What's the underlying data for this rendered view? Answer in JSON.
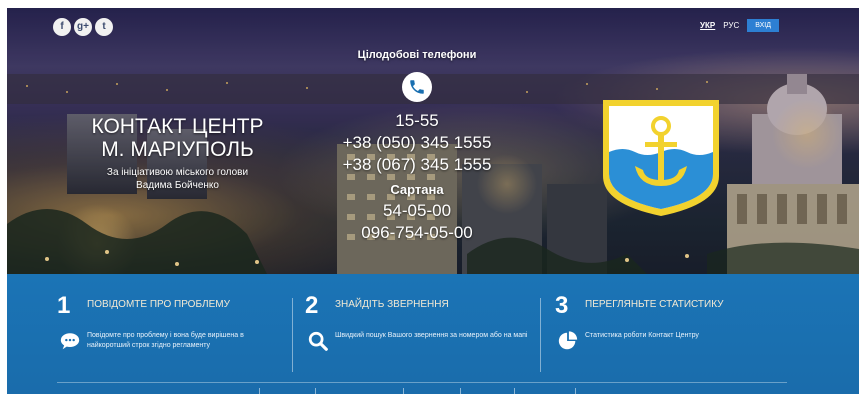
{
  "social": [
    {
      "name": "facebook",
      "glyph": "f"
    },
    {
      "name": "google-plus",
      "glyph": "g+"
    },
    {
      "name": "twitter",
      "glyph": "t"
    }
  ],
  "lang": {
    "ukr": "УКР",
    "rus": "РУС",
    "login": "ВХІД"
  },
  "title": {
    "line1": "КОНТАКТ ЦЕНТР",
    "line2": "М. МАРІУПОЛЬ",
    "line3": "За ініціативою міського голови",
    "line4": "Вадима Бойченко"
  },
  "phones": {
    "header": "Цілодобові телефони",
    "numbers": [
      "15-55",
      "+38 (050) 345 1555",
      "+38 (067) 345 1555"
    ],
    "sartana_label": "Сартана",
    "sartana_numbers": [
      "54-05-00",
      "096-754-05-00"
    ]
  },
  "steps": [
    {
      "number": "1",
      "heading": "ПОВІДОМТЕ ПРО ПРОБЛЕМУ",
      "text": "Повідомте про проблему і вона буде вирішена в найкоротший строк згідно регламенту",
      "icon": "chat-icon"
    },
    {
      "number": "2",
      "heading": "ЗНАЙДІТЬ ЗВЕРНЕННЯ",
      "text": "Швидкий пошук Вашого звернення за номером або на мапі",
      "icon": "search-icon"
    },
    {
      "number": "3",
      "heading": "ПЕРЕГЛЯНЬТЕ СТАТИСТИКУ",
      "text": "Статистика роботи Контакт Центру",
      "icon": "pie-chart-icon"
    }
  ],
  "colors": {
    "accent_blue": "#1a6fb0",
    "emblem_yellow": "#f2d22e",
    "emblem_blue": "#2b8fd6"
  }
}
